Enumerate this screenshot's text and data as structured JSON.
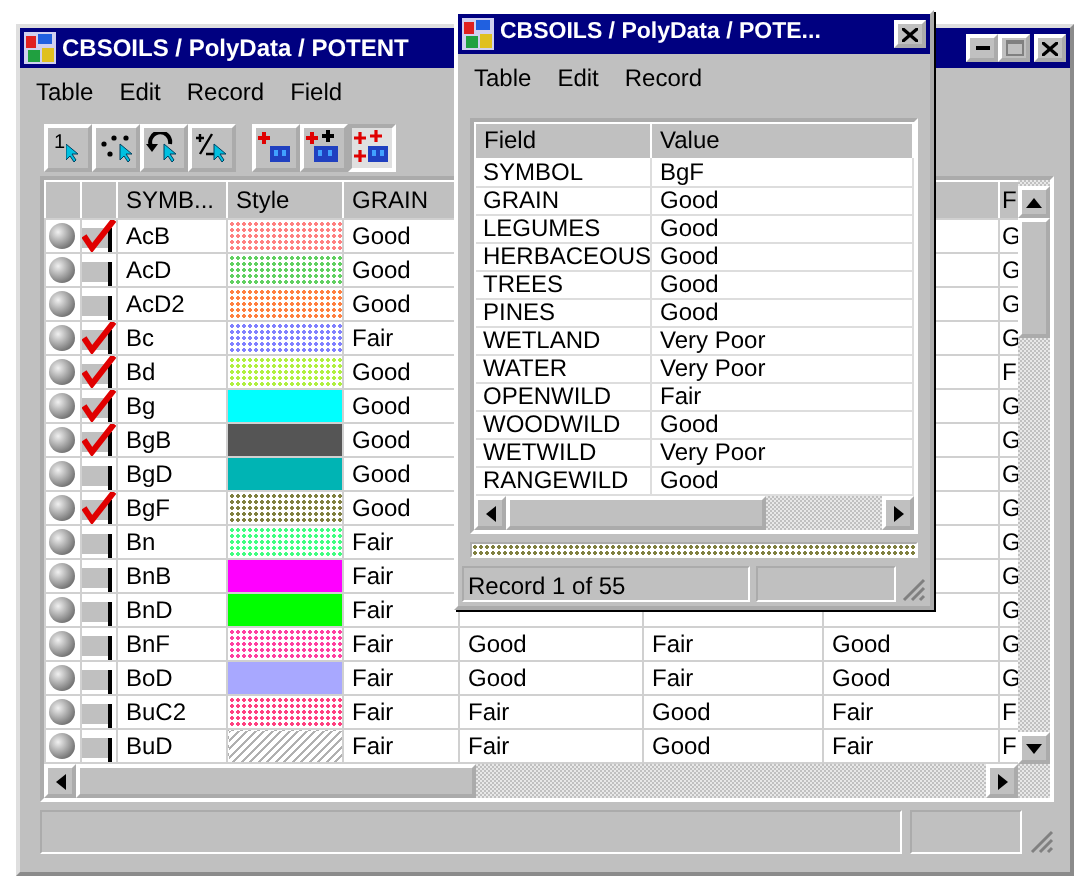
{
  "main_window": {
    "title": "CBSOILS / PolyData / POTENT",
    "menu": [
      "Table",
      "Edit",
      "Record",
      "Field"
    ]
  },
  "toolbar": [
    {
      "kind": "number",
      "label": "1",
      "pressed": false
    },
    {
      "kind": "points",
      "pressed": false
    },
    {
      "kind": "undo",
      "pressed": false
    },
    {
      "kind": "plusminus",
      "pressed": false
    },
    {
      "kind": "select-one",
      "pressed": false
    },
    {
      "kind": "select-add",
      "pressed": false
    },
    {
      "kind": "select-all",
      "pressed": true
    }
  ],
  "table": {
    "columns": [
      "SYMB...",
      "Style",
      "GRAIN",
      "F"
    ],
    "rows": [
      {
        "symbol": "AcB",
        "checked": true,
        "style": {
          "kind": "dots",
          "color": "#ff8080"
        },
        "grain": "Good",
        "last": "G"
      },
      {
        "symbol": "AcD",
        "checked": false,
        "style": {
          "kind": "dots",
          "color": "#60d060"
        },
        "grain": "Good",
        "last": "G"
      },
      {
        "symbol": "AcD2",
        "checked": false,
        "style": {
          "kind": "dots",
          "color": "#ff8040"
        },
        "grain": "Good",
        "last": "G"
      },
      {
        "symbol": "Bc",
        "checked": true,
        "style": {
          "kind": "dots",
          "color": "#8080ff"
        },
        "grain": "Fair",
        "last": "G"
      },
      {
        "symbol": "Bd",
        "checked": true,
        "style": {
          "kind": "dots",
          "color": "#b0f040"
        },
        "grain": "Good",
        "last": "F"
      },
      {
        "symbol": "Bg",
        "checked": true,
        "style": {
          "kind": "solid",
          "color": "#00ffff"
        },
        "grain": "Good",
        "last": "G"
      },
      {
        "symbol": "BgB",
        "checked": true,
        "style": {
          "kind": "solid",
          "color": "#555555"
        },
        "grain": "Good",
        "last": "G"
      },
      {
        "symbol": "BgD",
        "checked": false,
        "style": {
          "kind": "solid",
          "color": "#00b4b4"
        },
        "grain": "Good",
        "last": "G"
      },
      {
        "symbol": "BgF",
        "checked": true,
        "style": {
          "kind": "dots",
          "color": "#808040"
        },
        "grain": "Good",
        "last": "G"
      },
      {
        "symbol": "Bn",
        "checked": false,
        "style": {
          "kind": "dots",
          "color": "#40ff80"
        },
        "grain": "Fair",
        "last": "G"
      },
      {
        "symbol": "BnB",
        "checked": false,
        "style": {
          "kind": "solid",
          "color": "#ff00ff"
        },
        "grain": "Fair",
        "last": "G"
      },
      {
        "symbol": "BnD",
        "checked": false,
        "style": {
          "kind": "solid",
          "color": "#00ff00"
        },
        "grain": "Fair",
        "last": "G"
      },
      {
        "symbol": "BnF",
        "checked": false,
        "style": {
          "kind": "dots",
          "color": "#ff40a0"
        },
        "grain": "Fair",
        "more": [
          "Good",
          "Fair",
          "Good"
        ],
        "last": "G"
      },
      {
        "symbol": "BoD",
        "checked": false,
        "style": {
          "kind": "solid",
          "color": "#a8a8ff"
        },
        "grain": "Fair",
        "more": [
          "Good",
          "Fair",
          "Good"
        ],
        "last": "G"
      },
      {
        "symbol": "BuC2",
        "checked": false,
        "style": {
          "kind": "dots",
          "color": "#ff4080"
        },
        "grain": "Fair",
        "more": [
          "Fair",
          "Good",
          "Fair"
        ],
        "last": "F"
      },
      {
        "symbol": "BuD",
        "checked": false,
        "style": {
          "kind": "hatch",
          "color": "#b0b0b0"
        },
        "grain": "Fair",
        "more": [
          "Fair",
          "Good",
          "Fair"
        ],
        "last": "F"
      }
    ]
  },
  "record_window": {
    "title": "CBSOILS / PolyData / POTE...",
    "menu": [
      "Table",
      "Edit",
      "Record"
    ],
    "columns": [
      "Field",
      "Value"
    ],
    "rows": [
      {
        "field": "SYMBOL",
        "value": "BgF"
      },
      {
        "field": "GRAIN",
        "value": "Good"
      },
      {
        "field": "LEGUMES",
        "value": "Good"
      },
      {
        "field": "HERBACEOUS",
        "value": "Good"
      },
      {
        "field": "TREES",
        "value": "Good"
      },
      {
        "field": "PINES",
        "value": "Good"
      },
      {
        "field": "WETLAND",
        "value": "Very Poor"
      },
      {
        "field": "WATER",
        "value": "Very Poor"
      },
      {
        "field": "OPENWILD",
        "value": "Fair"
      },
      {
        "field": "WOODWILD",
        "value": "Good"
      },
      {
        "field": "WETWILD",
        "value": "Very Poor"
      },
      {
        "field": "RANGEWILD",
        "value": "Good"
      }
    ],
    "style_preview": {
      "kind": "dots",
      "color": "#808040"
    },
    "status": "Record 1 of 55"
  }
}
